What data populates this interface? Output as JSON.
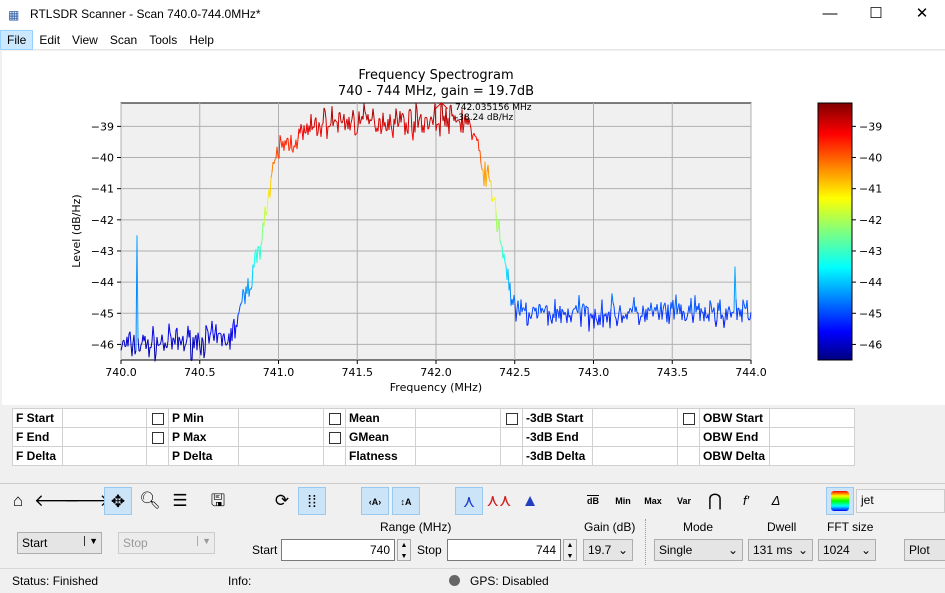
{
  "window": {
    "title": "RTLSDR Scanner - Scan 740.0-744.0MHz*"
  },
  "menu": [
    "File",
    "Edit",
    "View",
    "Scan",
    "Tools",
    "Help"
  ],
  "plot": {
    "title": "Frequency Spectrogram",
    "subtitle": "740 - 744 MHz, gain = 19.7dB",
    "annotation_freq": "742.035156 MHz",
    "annotation_level": "-38.24 dB/Hz"
  },
  "chart_data": {
    "type": "line",
    "xlabel": "Frequency (MHz)",
    "ylabel": "Level (dB/Hz)",
    "xlim": [
      740.0,
      744.0
    ],
    "ylim": [
      -46.5,
      -38.25
    ],
    "xticks": [
      "740.0",
      "740.5",
      "741.0",
      "741.5",
      "742.0",
      "742.5",
      "743.0",
      "743.5",
      "744.0"
    ],
    "yticks": [
      "-39",
      "-40",
      "-41",
      "-42",
      "-43",
      "-44",
      "-45",
      "-46"
    ],
    "colorbar_ticks": [
      "-39",
      "-40",
      "-41",
      "-42",
      "-43",
      "-44",
      "-45",
      "-46"
    ],
    "colormap": "jet",
    "grid": true,
    "profile_x": [
      740.0,
      740.7,
      740.85,
      741.0,
      741.3,
      742.2,
      742.35,
      742.5,
      744.0
    ],
    "profile_y": [
      -46.05,
      -45.8,
      -43.5,
      -39.7,
      -38.85,
      -38.8,
      -41.0,
      -45.0,
      -45.0
    ],
    "noise_db": 0.35,
    "spikes": [
      {
        "x": 740.1,
        "y": -42.5
      },
      {
        "x": 743.9,
        "y": -43.5
      }
    ],
    "peak": {
      "x": 742.035156,
      "y": -38.24
    }
  },
  "measurements": {
    "col1": [
      "F Start",
      "F End",
      "F Delta"
    ],
    "col2": [
      "P Min",
      "P Max",
      "P Delta"
    ],
    "col3": [
      "Mean",
      "GMean",
      "Flatness"
    ],
    "col4": [
      "-3dB Start",
      "-3dB End",
      "-3dB Delta"
    ],
    "col5": [
      "OBW Start",
      "OBW End",
      "OBW Delta"
    ]
  },
  "toolbar": {
    "db": "dB",
    "min": "Min",
    "max": "Max",
    "var": "Var",
    "colormap": "jet"
  },
  "controls": {
    "start_btn": "Start",
    "stop_btn": "Stop",
    "range_label": "Range (MHz)",
    "start_label": "Start",
    "start_value": "740",
    "stop_label": "Stop",
    "stop_value": "744",
    "gain_label": "Gain (dB)",
    "gain_value": "19.7",
    "mode_label": "Mode",
    "mode_value": "Single",
    "dwell_label": "Dwell",
    "dwell_value": "131 ms",
    "fft_label": "FFT size",
    "fft_value": "1024",
    "plot_btn": "Plot"
  },
  "status": {
    "status": "Status: Finished",
    "info": "Info:",
    "gps": "GPS: Disabled"
  }
}
